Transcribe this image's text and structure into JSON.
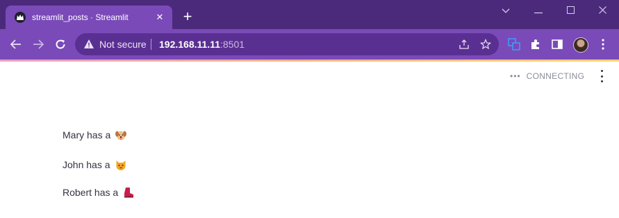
{
  "browser": {
    "tab_title": "streamlit_posts · Streamlit",
    "tab_close_icon": "close-icon",
    "new_tab_icon": "plus-icon",
    "security_label": "Not secure",
    "url_host": "192.168.11.11",
    "url_port": ":8501"
  },
  "app": {
    "status_text": "CONNECTING",
    "posts": [
      {
        "text": "Mary has a",
        "emoji": "dog-face-icon"
      },
      {
        "text": "John has a",
        "emoji": "cat-face-icon"
      },
      {
        "text": "Robert has a",
        "emoji": "boot-icon"
      }
    ]
  },
  "colors": {
    "tab_bar": "#4b2a7c",
    "toolbar": "#7a4ab8",
    "omnibox": "#5a2f92",
    "text": "#31333f",
    "status": "#8a8d99"
  }
}
